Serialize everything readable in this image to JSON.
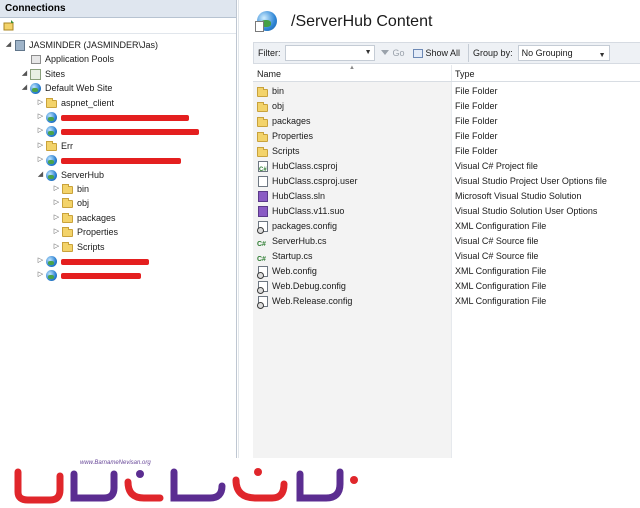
{
  "connections": {
    "title": "Connections",
    "tree": [
      {
        "label": "JASMINDER (JASMINDER\\Jas)",
        "icon": "server-icon",
        "expander": "◢",
        "level": 0,
        "redacted": false
      },
      {
        "label": "Application Pools",
        "icon": "app-pool-icon",
        "expander": "",
        "level": 1,
        "redacted": false
      },
      {
        "label": "Sites",
        "icon": "sites-icon",
        "expander": "◢",
        "level": 1,
        "redacted": false
      },
      {
        "label": "Default Web Site",
        "icon": "globe-icon",
        "expander": "◢",
        "level": 2,
        "redacted": false
      },
      {
        "label": "aspnet_client",
        "icon": "folder-icon",
        "expander": "▷",
        "level": 3,
        "redacted": false
      },
      {
        "label": "",
        "icon": "globe-icon",
        "expander": "▷",
        "level": 3,
        "redacted": true
      },
      {
        "label": "",
        "icon": "globe-icon",
        "expander": "▷",
        "level": 3,
        "redacted": true
      },
      {
        "label": "Err",
        "icon": "folder-icon",
        "expander": "▷",
        "level": 3,
        "redacted": false
      },
      {
        "label": "",
        "icon": "globe-icon",
        "expander": "▷",
        "level": 3,
        "redacted": true
      },
      {
        "label": "ServerHub",
        "icon": "globe-icon",
        "expander": "◢",
        "level": 3,
        "redacted": false
      },
      {
        "label": "bin",
        "icon": "folder-icon",
        "expander": "▷",
        "level": 4,
        "redacted": false
      },
      {
        "label": "obj",
        "icon": "folder-icon",
        "expander": "▷",
        "level": 4,
        "redacted": false
      },
      {
        "label": "packages",
        "icon": "folder-icon",
        "expander": "▷",
        "level": 4,
        "redacted": false
      },
      {
        "label": "Properties",
        "icon": "folder-icon",
        "expander": "▷",
        "level": 4,
        "redacted": false
      },
      {
        "label": "Scripts",
        "icon": "folder-icon",
        "expander": "▷",
        "level": 4,
        "redacted": false
      },
      {
        "label": "",
        "icon": "globe-icon",
        "expander": "▷",
        "level": 3,
        "redacted": true
      },
      {
        "label": "",
        "icon": "globe-icon",
        "expander": "▷",
        "level": 3,
        "redacted": true
      }
    ]
  },
  "content": {
    "title": "/ServerHub Content",
    "filter": {
      "label": "Filter:",
      "value": "",
      "go_label": "Go",
      "show_all_label": "Show All",
      "group_by_label": "Group by:",
      "group_by_value": "No Grouping"
    },
    "columns": {
      "name": "Name",
      "type": "Type"
    },
    "rows": [
      {
        "name": "bin",
        "type": "File Folder",
        "icon": "folder-icon"
      },
      {
        "name": "obj",
        "type": "File Folder",
        "icon": "folder-icon"
      },
      {
        "name": "packages",
        "type": "File Folder",
        "icon": "folder-icon"
      },
      {
        "name": "Properties",
        "type": "File Folder",
        "icon": "folder-icon"
      },
      {
        "name": "Scripts",
        "type": "File Folder",
        "icon": "folder-icon"
      },
      {
        "name": "HubClass.csproj",
        "type": "Visual C# Project file",
        "icon": "csproj-icon"
      },
      {
        "name": "HubClass.csproj.user",
        "type": "Visual Studio Project User Options file",
        "icon": "user-file-icon"
      },
      {
        "name": "HubClass.sln",
        "type": "Microsoft Visual Studio Solution",
        "icon": "solution-icon"
      },
      {
        "name": "HubClass.v11.suo",
        "type": "Visual Studio Solution User Options",
        "icon": "suo-icon"
      },
      {
        "name": "packages.config",
        "type": "XML Configuration File",
        "icon": "config-icon"
      },
      {
        "name": "ServerHub.cs",
        "type": "Visual C# Source file",
        "icon": "csharp-icon"
      },
      {
        "name": "Startup.cs",
        "type": "Visual C# Source file",
        "icon": "csharp-icon"
      },
      {
        "name": "Web.config",
        "type": "XML Configuration File",
        "icon": "config-icon"
      },
      {
        "name": "Web.Debug.config",
        "type": "XML Configuration File",
        "icon": "config-icon"
      },
      {
        "name": "Web.Release.config",
        "type": "XML Configuration File",
        "icon": "config-icon"
      }
    ]
  },
  "watermark": {
    "url": "www.BarnameNevisan.org",
    "logo_text": "برنامه نویسان",
    "colors": {
      "logo_red": "#e0262b",
      "logo_purple": "#5b2d91"
    }
  },
  "colors": {
    "redaction": "#e41f1f",
    "header_bg": "#dfe6ef"
  }
}
